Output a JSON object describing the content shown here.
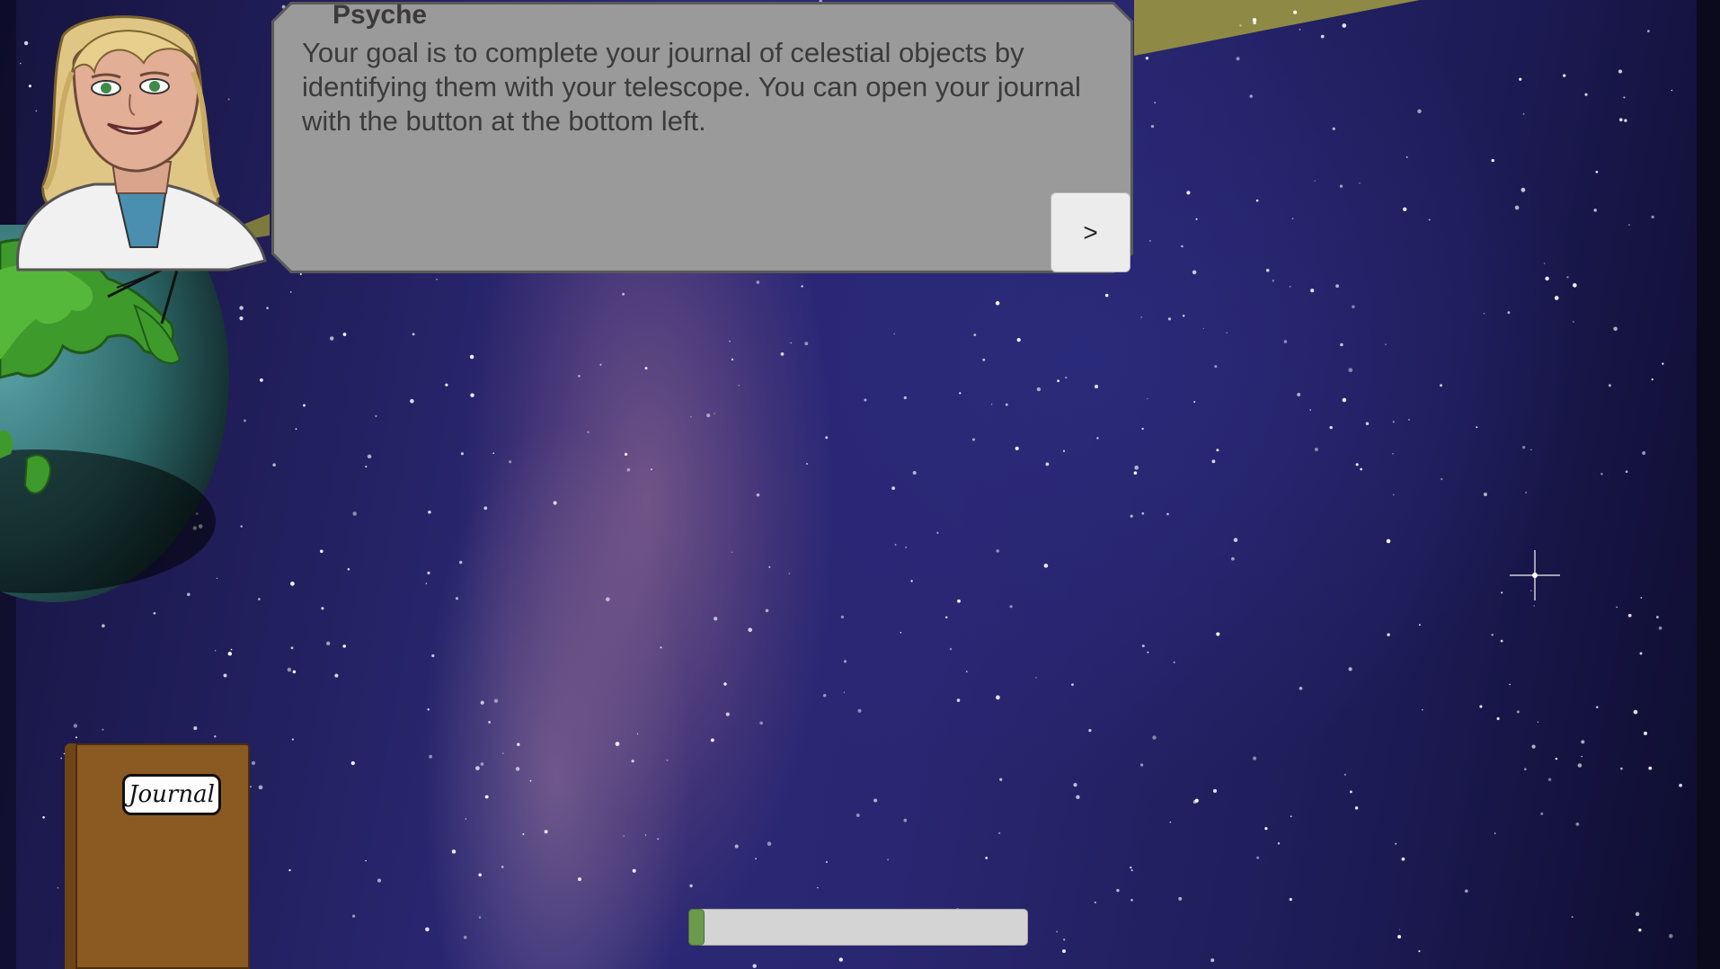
{
  "dialog": {
    "speaker": "Psyche",
    "text": "Your goal is to complete your journal of celestial objects by identifying them with your telescope. You can open your journal with the button at the bottom left.",
    "next_label": ">"
  },
  "journal": {
    "label": "Journal"
  },
  "progress": {
    "value": 0.04
  },
  "colors": {
    "dialog_bg": "#9a9a9a",
    "journal_brown": "#8b5a22",
    "progress_green": "#6a9a4c",
    "beam_olive": "#8e8a45"
  }
}
